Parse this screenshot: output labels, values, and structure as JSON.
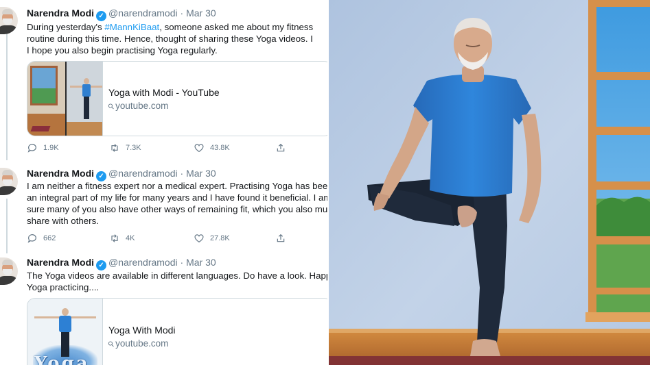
{
  "tweets": [
    {
      "name": "Narendra Modi",
      "handle": "@narendramodi",
      "date": "Mar 30",
      "lines": [
        [
          "During yesterday's ",
          "#MannKiBaat",
          ", someone asked me about my fitness"
        ],
        [
          "routine during this time. Hence, thought of sharing these Yoga videos.  I"
        ],
        [
          "I hope you also begin practising Yoga regularly."
        ]
      ],
      "card": {
        "title": "Yoga with Modi - YouTube",
        "domain": "youtube.com"
      },
      "stats": {
        "replies": "1.9K",
        "retweets": "7.3K",
        "likes": "43.8K"
      }
    },
    {
      "name": "Narendra Modi",
      "handle": "@narendramodi",
      "date": "Mar 30",
      "lines": [
        "I am neither a fitness expert nor a medical expert. Practising Yoga has been",
        "an integral part of my life for many years and I have found it beneficial. I am",
        "sure many of you also have other ways of remaining fit, which you also must",
        "share with others."
      ],
      "stats": {
        "replies": "662",
        "retweets": "4K",
        "likes": "27.8K"
      }
    },
    {
      "name": "Narendra Modi",
      "handle": "@narendramodi",
      "date": "Mar 30",
      "lines": [
        "The Yoga videos are available in different languages. Do have a look. Happy",
        "Yoga practicing...."
      ],
      "card": {
        "title": "Yoga With Modi",
        "domain": "youtube.com",
        "thumb_text": "Yoga"
      }
    }
  ],
  "icons": {
    "verified": "verified-badge-icon",
    "reply": "reply-icon",
    "retweet": "retweet-icon",
    "like": "heart-icon",
    "share": "share-icon",
    "link": "link-icon"
  },
  "colors": {
    "link_blue": "#1d9bf0",
    "muted_text": "#657786",
    "border": "#cfd9de",
    "shirt_blue": "#2f7fd6",
    "wall": "#b9cce4",
    "floor": "#c0772f",
    "window_frame": "#d6904a"
  }
}
